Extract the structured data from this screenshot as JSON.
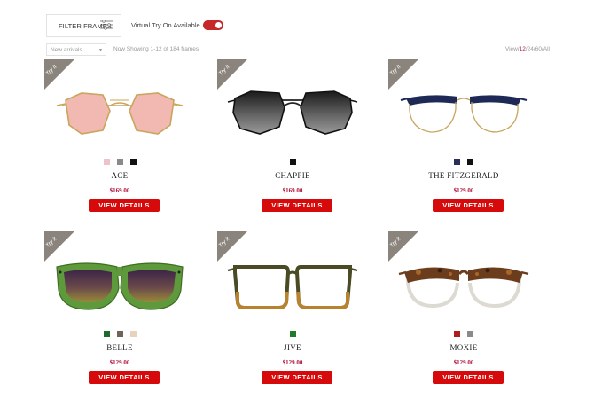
{
  "toolbar": {
    "filter_label": "FILTER FRAMES",
    "vto_label": "Virtual Try On Available",
    "vto_enabled": true,
    "sort_value": "New arrivals",
    "showing_text": "Now Showing 1-12 of 184 frames",
    "view_prefix": "View/",
    "view_options": [
      "12",
      "/24",
      "/60",
      "/All"
    ],
    "view_selected": "12"
  },
  "colors": {
    "accent": "#d60a0a",
    "price": "#b2123a",
    "tryit_badge": "#8a847c"
  },
  "try_it_label": "Try it",
  "details_label": "VIEW DETAILS",
  "products": [
    {
      "name": "ACE",
      "price": "$169.00",
      "swatches": [
        "#f0c1c9",
        "#8a8a8a",
        "#111111"
      ]
    },
    {
      "name": "CHAPPIE",
      "price": "$169.00",
      "swatches": [
        "#111111"
      ]
    },
    {
      "name": "THE FITZGERALD",
      "price": "$129.00",
      "swatches": [
        "#2b2f5c",
        "#111111"
      ]
    },
    {
      "name": "BELLE",
      "price": "$129.00",
      "swatches": [
        "#1f6b2e",
        "#6d6357",
        "#e6d3bc"
      ]
    },
    {
      "name": "JIVE",
      "price": "$129.00",
      "swatches": [
        "#1f7a2c"
      ]
    },
    {
      "name": "MOXIE",
      "price": "$129.00",
      "swatches": [
        "#b01d1d",
        "#8a8a8a"
      ]
    }
  ]
}
